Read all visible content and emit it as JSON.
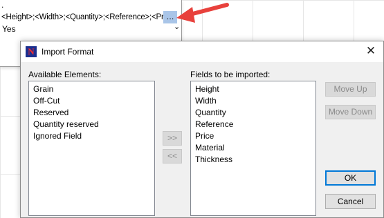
{
  "background": {
    "dot": ".",
    "format_text": "<Height>;<Width>;<Quantity>;<Reference>;<Price>",
    "more_button": "...",
    "yes_value": "Yes",
    "dropdown_icon": "chevron-down-icon"
  },
  "colors": {
    "annotation_arrow": "#e8413c",
    "selection_highlight": "#a9c5e8",
    "default_button_border": "#0078d7"
  },
  "dialog": {
    "title": "Import Format",
    "app_icon_letter": "N",
    "close_symbol": "✕",
    "available_label": "Available Elements:",
    "available_items": [
      "Grain",
      "Off-Cut",
      "Reserved",
      "Quantity reserved",
      "Ignored Field"
    ],
    "imported_label": "Fields to be imported:",
    "imported_items": [
      "Height",
      "Width",
      "Quantity",
      "Reference",
      "Price",
      "Material",
      "Thickness"
    ],
    "add_button": ">>",
    "remove_button": "<<",
    "move_up_button": "Move Up",
    "move_down_button": "Move Down",
    "ok_button": "OK",
    "cancel_button": "Cancel"
  }
}
